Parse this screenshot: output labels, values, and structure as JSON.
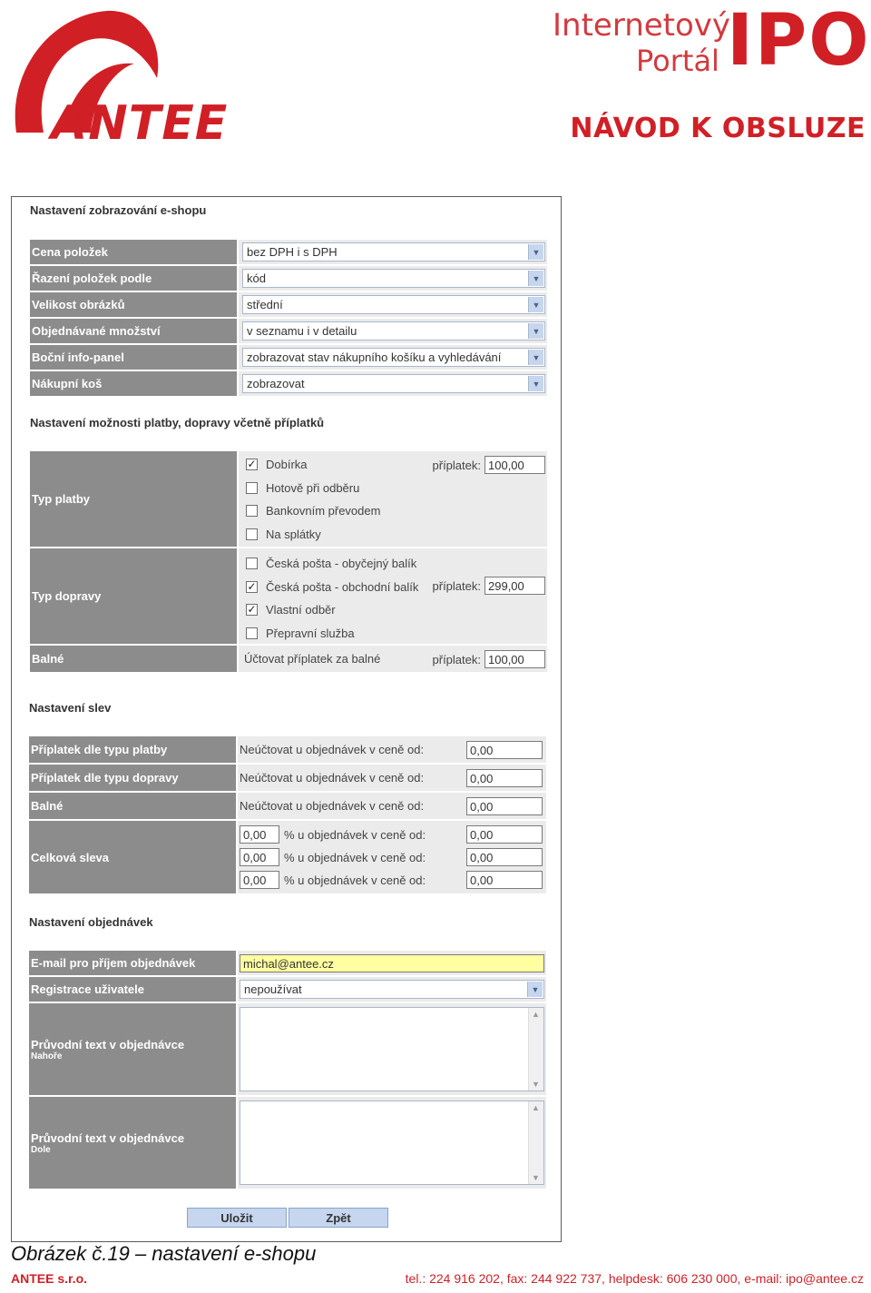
{
  "header": {
    "company_logo_text": "ANTEE",
    "portal_line1": "Internetový",
    "portal_line2": "Portál",
    "portal_abbr": "IPO",
    "doc_title": "NÁVOD K OBSLUZE"
  },
  "display": {
    "title": "Nastavení zobrazování e-shopu",
    "rows": [
      {
        "label": "Cena položek",
        "value": "bez DPH i s DPH"
      },
      {
        "label": "Řazení položek podle",
        "value": "kód"
      },
      {
        "label": "Velikost obrázků",
        "value": "střední"
      },
      {
        "label": "Objednávané množství",
        "value": "v seznamu i v detailu"
      },
      {
        "label": "Boční info-panel",
        "value": "zobrazovat stav nákupního košíku a vyhledávání"
      },
      {
        "label": "Nákupní koš",
        "value": "zobrazovat"
      }
    ]
  },
  "payment": {
    "title": "Nastavení možnosti platby, dopravy včetně příplatků",
    "payment_label": "Typ platby",
    "payment_options": [
      {
        "label": "Dobírka",
        "checked": "✓"
      },
      {
        "label": "Hotově při odběru",
        "checked": ""
      },
      {
        "label": "Bankovním převodem",
        "checked": ""
      },
      {
        "label": "Na splátky",
        "checked": ""
      }
    ],
    "payment_fee_label": "příplatek:",
    "payment_fee": "100,00",
    "shipping_label": "Typ dopravy",
    "shipping_options": [
      {
        "label": "Česká pošta - obyčejný balík",
        "checked": ""
      },
      {
        "label": "Česká pošta - obchodní balík",
        "checked": "✓"
      },
      {
        "label": "Vlastní odběr",
        "checked": "✓"
      },
      {
        "label": "Přepravní služba",
        "checked": ""
      }
    ],
    "shipping_fee_label": "příplatek:",
    "shipping_fee": "299,00",
    "packing_label": "Balné",
    "packing_text": "Účtovat příplatek za balné",
    "packing_fee_label": "příplatek:",
    "packing_fee": "100,00"
  },
  "discounts": {
    "title": "Nastavení slev",
    "rows": [
      {
        "label": "Příplatek dle typu platby",
        "text": "Neúčtovat u objednávek v ceně od:",
        "value": "0,00"
      },
      {
        "label": "Příplatek dle typu dopravy",
        "text": "Neúčtovat u objednávek v ceně od:",
        "value": "0,00"
      },
      {
        "label": "Balné",
        "text": "Neúčtovat u objednávek v ceně od:",
        "value": "0,00"
      }
    ],
    "total_label": "Celková sleva",
    "total_rows": [
      {
        "pct": "0,00",
        "text": "% u objednávek v ceně od:",
        "value": "0,00"
      },
      {
        "pct": "0,00",
        "text": "% u objednávek v ceně od:",
        "value": "0,00"
      },
      {
        "pct": "0,00",
        "text": "% u objednávek v ceně od:",
        "value": "0,00"
      }
    ]
  },
  "orders": {
    "title": "Nastavení objednávek",
    "email_label": "E-mail pro příjem objednávek",
    "email_value": "michal@antee.cz",
    "registration_label": "Registrace uživatele",
    "registration_value": "nepoužívat",
    "top_text_label": "Průvodní text v objednávce",
    "top_text_sub": "Nahoře",
    "bottom_text_label": "Průvodní text v objednávce",
    "bottom_text_sub": "Dole"
  },
  "buttons": {
    "save": "Uložit",
    "back": "Zpět"
  },
  "caption": "Obrázek č.19 – nastavení e-shopu",
  "footer": {
    "left": "ANTEE s.r.o.",
    "right": "tel.: 224 916 202, fax: 244 922 737, helpdesk: 606 230 000, e-mail: ipo@antee.cz"
  },
  "colors": {
    "brand_red": "#d11f26",
    "label_gray": "#8c8c8c",
    "highlight_yellow": "#ffffa0"
  }
}
